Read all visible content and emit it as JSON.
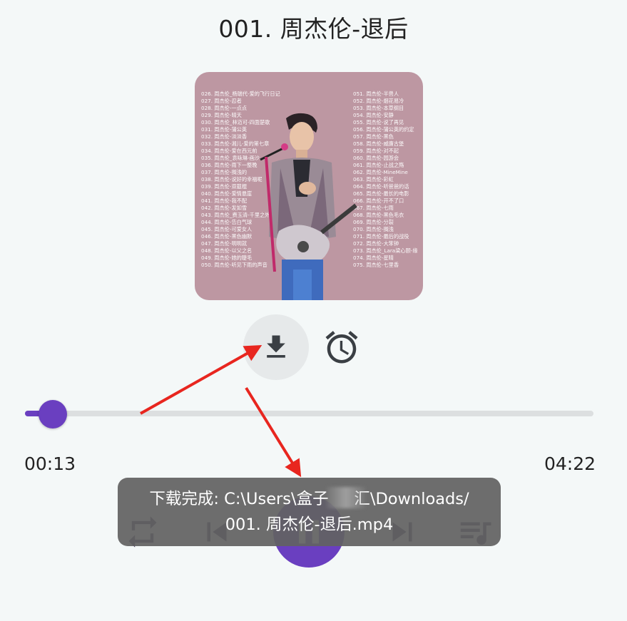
{
  "song_title": "001. 周杰伦-退后",
  "cover": {
    "list_left": [
      "026. 周杰伦_杨瑞代-爱的飞行日记",
      "027. 周杰伦-忍者",
      "028. 周杰伦-一点点",
      "029. 周杰伦-晴天",
      "030. 周杰伦_林迈可-四面楚歌",
      "031. 周杰伦-蒲公英",
      "032. 周杰伦-淡淡香",
      "033. 周杰伦-湘儿-爱的第七章",
      "034. 周杰伦-爱在西元前",
      "035. 周杰伦_袁咏琳-画沙",
      "036. 周杰伦-雨下一整晚",
      "037. 周杰伦-搁浅的",
      "038. 周杰伦-说好的幸福呢",
      "039. 周杰伦-双截棍",
      "040. 周杰伦-爱情悬崖",
      "041. 周杰伦-我不配",
      "042. 周杰伦-发如雪",
      "043. 周杰伦_费玉清-千里之外",
      "044. 周杰伦-告白气球",
      "045. 周杰伦-可爱女人",
      "046. 周杰伦-黑色幽默",
      "047. 周杰伦-明明就",
      "048. 周杰伦-以父之名",
      "049. 周杰伦-她的睫毛",
      "050. 周杰伦-听见下雨的声音"
    ],
    "list_right": [
      "051. 周杰伦-半兽人",
      "052. 周杰伦-烟花易冷",
      "053. 周杰伦-本草纲目",
      "054. 周杰伦-安静",
      "055. 周杰伦-说了再见",
      "056. 周杰伦-蒲公英的约定",
      "057. 周杰伦-黑色",
      "058. 周杰伦-威廉古堡",
      "059. 周杰伦-对不起",
      "060. 周杰伦-园游会",
      "061. 周杰伦-止战之殇",
      "062. 周杰伦-MineMine",
      "063. 周杰伦-彩虹",
      "064. 周杰伦-听爸爸的话",
      "065. 周杰伦-最长的电影",
      "066. 周杰伦-开不了口",
      "067. 周杰伦-七雨",
      "068. 周杰伦-黑色毛衣",
      "069. 周杰伦-分裂",
      "070. 周杰伦-搁浅",
      "071. 周杰伦-最后的战役",
      "072. 周杰伦-大笨钟",
      "073. 周杰伦_Lara梁心颐-缘",
      "074. 周杰伦-星晴",
      "075. 周杰伦-七里香"
    ]
  },
  "icons": {
    "download": "download-icon",
    "alarm": "alarm-clock-icon",
    "repeat": "repeat-icon",
    "previous": "skip-previous-icon",
    "play_pause": "pause-icon",
    "next": "skip-next-icon",
    "playlist": "playlist-icon"
  },
  "playback": {
    "current_time": "00:13",
    "total_time": "04:22",
    "progress_fraction": 0.05
  },
  "toast": {
    "line1": "下载完成: C:\\Users\\盒子     汇\\Downloads/",
    "line2": "001. 周杰伦-退后.mp4"
  },
  "colors": {
    "accent": "#6a3fc0",
    "background": "#f4f8f8",
    "cover_bg": "#bd97a2",
    "toast_bg": "#626262",
    "annotation": "#e8261f"
  }
}
